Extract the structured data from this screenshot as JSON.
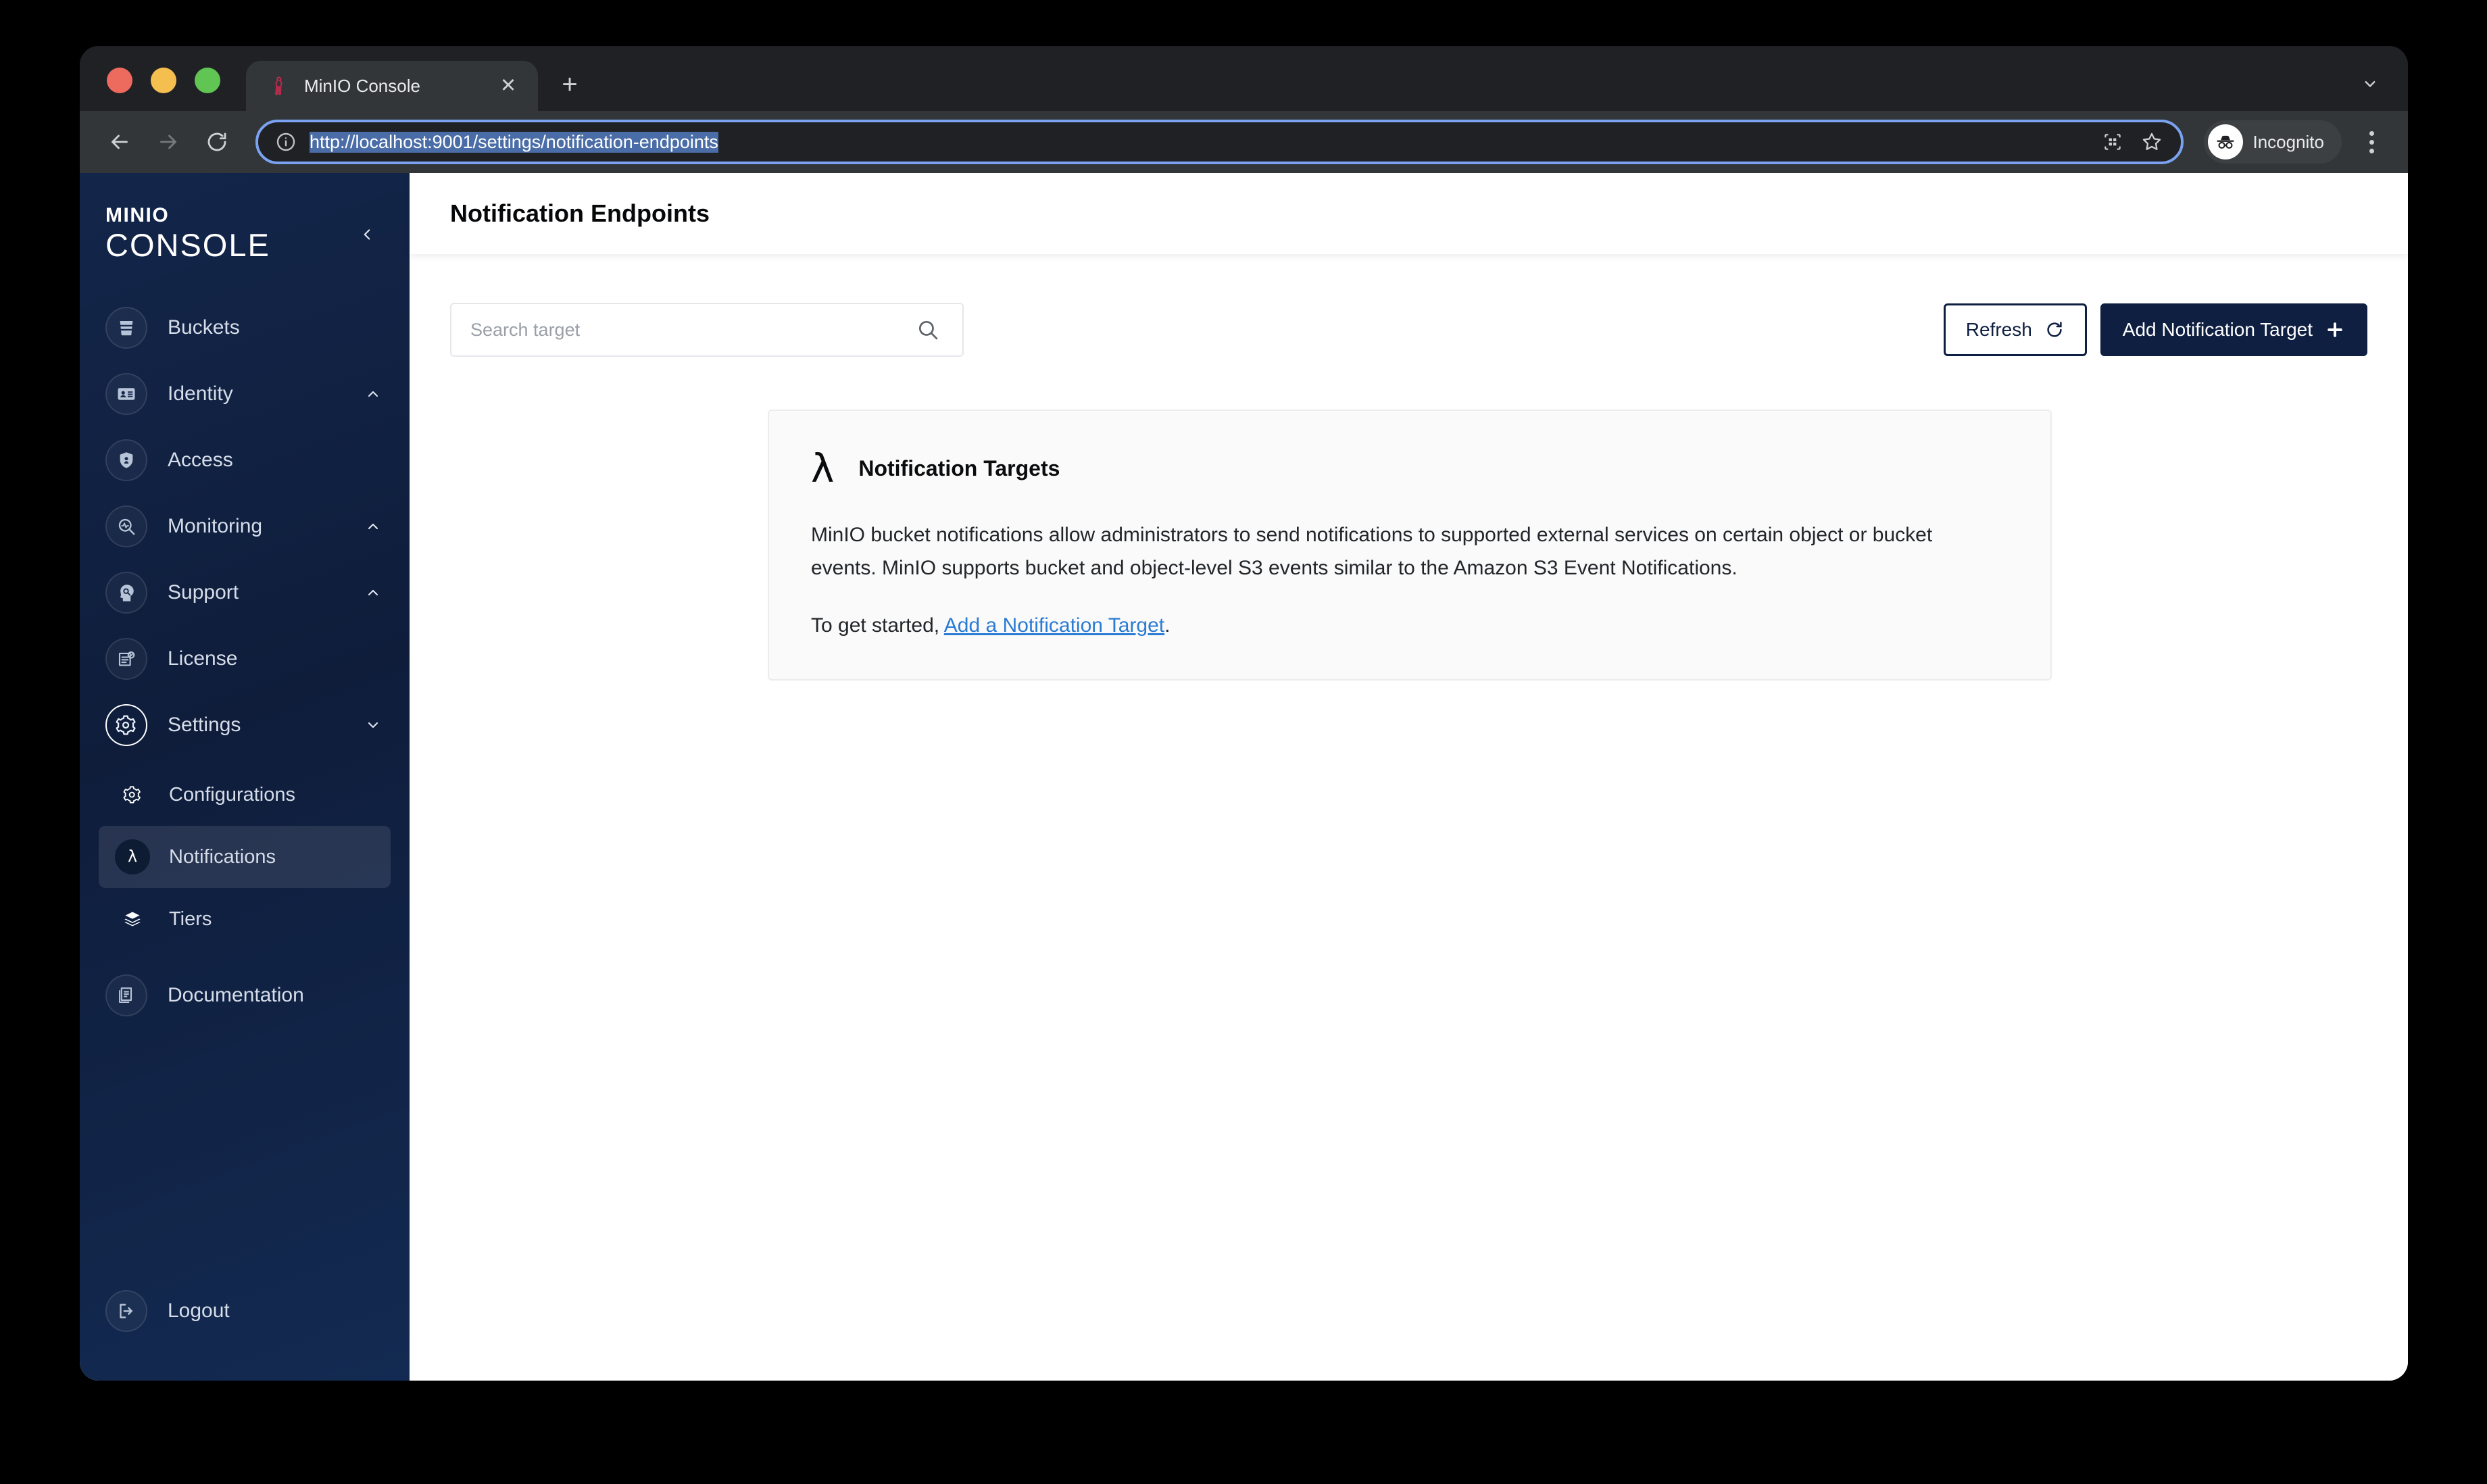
{
  "browser": {
    "tab": {
      "title": "MinIO Console",
      "favicon_icon": "minio-flamingo-icon",
      "close_icon": "close-icon"
    },
    "new_tab_icon": "plus-icon",
    "tabstrip_chevron_icon": "chevron-down-icon",
    "nav": {
      "back_icon": "arrow-left-icon",
      "forward_icon": "arrow-right-icon",
      "reload_icon": "reload-icon"
    },
    "omnibox": {
      "info_icon": "info-circle-icon",
      "url": "http://localhost:9001/settings/notification-endpoints",
      "url_selected": true,
      "qr_icon": "qr-code-icon",
      "bookmark_icon": "star-icon"
    },
    "profile": {
      "label": "Incognito",
      "icon": "incognito-icon"
    },
    "menu_icon": "kebab-menu-icon"
  },
  "sidebar": {
    "logo": {
      "top": "MINIO",
      "bottom": "CONSOLE"
    },
    "collapse_icon": "chevron-left-icon",
    "items": [
      {
        "label": "Buckets",
        "icon": "bucket-icon",
        "expandable": false,
        "active": false
      },
      {
        "label": "Identity",
        "icon": "identity-card-icon",
        "expandable": true,
        "chevron": "chevron-up-icon",
        "active": false
      },
      {
        "label": "Access",
        "icon": "lock-shield-icon",
        "expandable": false,
        "active": false
      },
      {
        "label": "Monitoring",
        "icon": "monitoring-icon",
        "expandable": true,
        "chevron": "chevron-up-icon",
        "active": false
      },
      {
        "label": "Support",
        "icon": "support-head-icon",
        "expandable": true,
        "chevron": "chevron-up-icon",
        "active": false
      },
      {
        "label": "License",
        "icon": "license-icon",
        "expandable": false,
        "active": false
      },
      {
        "label": "Settings",
        "icon": "gear-icon",
        "expandable": true,
        "chevron": "chevron-down-icon",
        "active": true
      }
    ],
    "subitems": [
      {
        "label": "Configurations",
        "icon": "gear-icon",
        "selected": false
      },
      {
        "label": "Notifications",
        "icon": "lambda-icon",
        "selected": true
      },
      {
        "label": "Tiers",
        "icon": "layers-icon",
        "selected": false
      }
    ],
    "bottom_items": [
      {
        "label": "Documentation",
        "icon": "documentation-icon"
      },
      {
        "label": "Logout",
        "icon": "logout-icon"
      }
    ]
  },
  "page": {
    "title": "Notification Endpoints",
    "search": {
      "placeholder": "Search target",
      "value": "",
      "icon": "search-icon"
    },
    "refresh_button": {
      "label": "Refresh",
      "icon": "refresh-icon"
    },
    "add_button": {
      "label": "Add Notification Target",
      "icon": "plus-icon"
    },
    "info_panel": {
      "icon": "lambda-icon",
      "title": "Notification Targets",
      "body": "MinIO bucket notifications allow administrators to send notifications to supported external services on certain object or bucket events. MinIO supports bucket and object-level S3 events similar to the Amazon S3 Event Notifications.",
      "get_started_prefix": "To get started, ",
      "get_started_link": "Add a Notification Target",
      "get_started_suffix": "."
    }
  },
  "colors": {
    "sidebar_navy": "#0f1d3b",
    "primary_navy": "#0e1f41",
    "link_blue": "#2a7bd4",
    "panel_bg": "#fafafa"
  }
}
